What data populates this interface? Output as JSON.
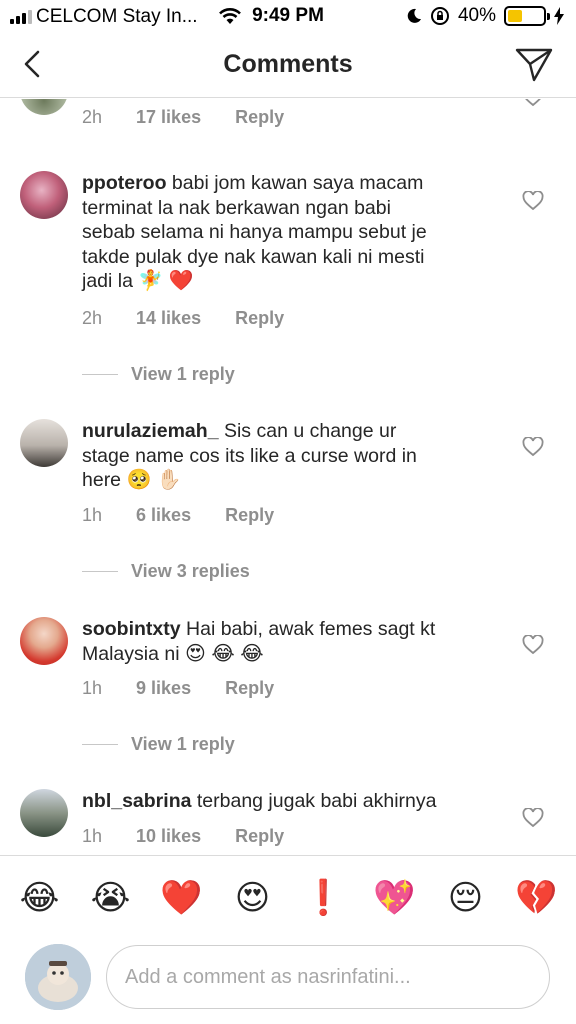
{
  "status": {
    "carrier": "CELCOM Stay In...",
    "time": "9:49 PM",
    "battery": "40%",
    "battery_level": 0.4
  },
  "nav": {
    "title": "Comments"
  },
  "top_partial": {
    "time": "2h",
    "likes": "17 likes",
    "reply": "Reply"
  },
  "comments": [
    {
      "username": "ppoteroo",
      "lines": [
        "babi jom kawan saya macam",
        "terminat la nak berkawan ngan babi",
        "sebab selama ni hanya mampu sebut je",
        "takde pulak dye nak kawan  kali ni mesti",
        "jadi la"
      ],
      "emoji": "🧚 ❤️",
      "time": "2h",
      "likes": "14 likes",
      "reply": "Reply",
      "view_replies": "View 1 reply"
    },
    {
      "username": "nurulaziemah_",
      "lines": [
        "Sis can u change ur",
        "stage name cos its like a curse word in",
        "here"
      ],
      "emoji": "🥺 ✋🏻",
      "time": "1h",
      "likes": "6 likes",
      "reply": "Reply",
      "view_replies": "View 3 replies"
    },
    {
      "username": "soobintxty",
      "lines": [
        "Hai babi, awak femes sagt kt",
        "Malaysia ni"
      ],
      "emoji": "😍 😂 😂",
      "time": "1h",
      "likes": "9 likes",
      "reply": "Reply",
      "view_replies": "View 1 reply"
    },
    {
      "username": "nbl_sabrina",
      "lines": [
        "terbang jugak babi akhirnya"
      ],
      "emoji": "",
      "time": "1h",
      "likes": "10 likes",
      "reply": "Reply"
    }
  ],
  "emoji_bar": [
    "😂",
    "😭",
    "❤️",
    "😍",
    "❗",
    "💖",
    "😔",
    "💔"
  ],
  "input": {
    "placeholder": "Add a comment as nasrinfatini..."
  }
}
